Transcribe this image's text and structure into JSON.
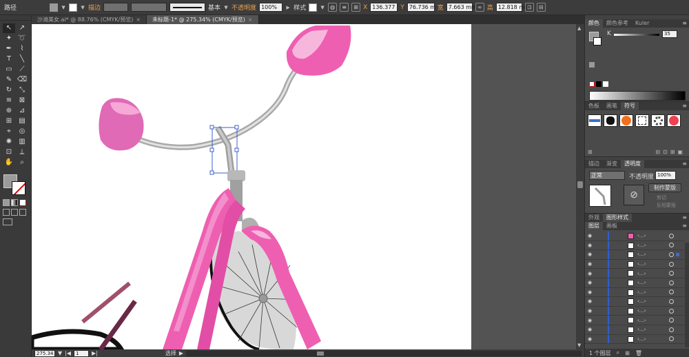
{
  "control_bar": {
    "mode_label": "路径",
    "stroke_label": "描边",
    "stroke_style_label": "基本",
    "opacity_label": "不透明度",
    "opacity_value": "100%",
    "style_label": "样式",
    "x_label": "X",
    "x_value": "136.377",
    "y_label": "Y",
    "y_value": "76.736 m",
    "w_label": "宽",
    "w_value": "7.663 mm",
    "h_label": "高",
    "h_value": "12.818 mm"
  },
  "tabs": [
    {
      "label": "沙滩美女.ai* @ 88.76% (CMYK/预览)",
      "close": "×"
    },
    {
      "label": "未标题-1* @ 275.34% (CMYK/预览)",
      "close": "×"
    }
  ],
  "status": {
    "zoom": "275.34",
    "page": "1",
    "tool_label": "选择"
  },
  "panels": {
    "color_tabs": [
      "颜色",
      "颜色参考",
      "Kuler"
    ],
    "k_label": "K",
    "k_value": "35",
    "swatch_tabs": [
      "色板",
      "画笔",
      "符号"
    ],
    "transp_tabs": [
      "描边",
      "渐变",
      "透明度"
    ],
    "blend_mode": "正常",
    "transp_opacity_label": "不透明度",
    "transp_opacity_value": "100%",
    "make_mask_label": "制作蒙版",
    "clip_label": "剪切",
    "invert_mask_label": "反相蒙版",
    "appearance_tabs": [
      "外观",
      "图形样式"
    ],
    "layers_tabs": [
      "图层",
      "画板"
    ],
    "layers_footer": "1 个图层"
  },
  "colors": {
    "pink": "#ee5fb1",
    "pink_dark": "#d94e9f",
    "pink_light": "#f6a8d6",
    "gray_bar": "#c9c9c9",
    "selection": "#3d5fc8",
    "accent_orange": "#e8a050"
  }
}
